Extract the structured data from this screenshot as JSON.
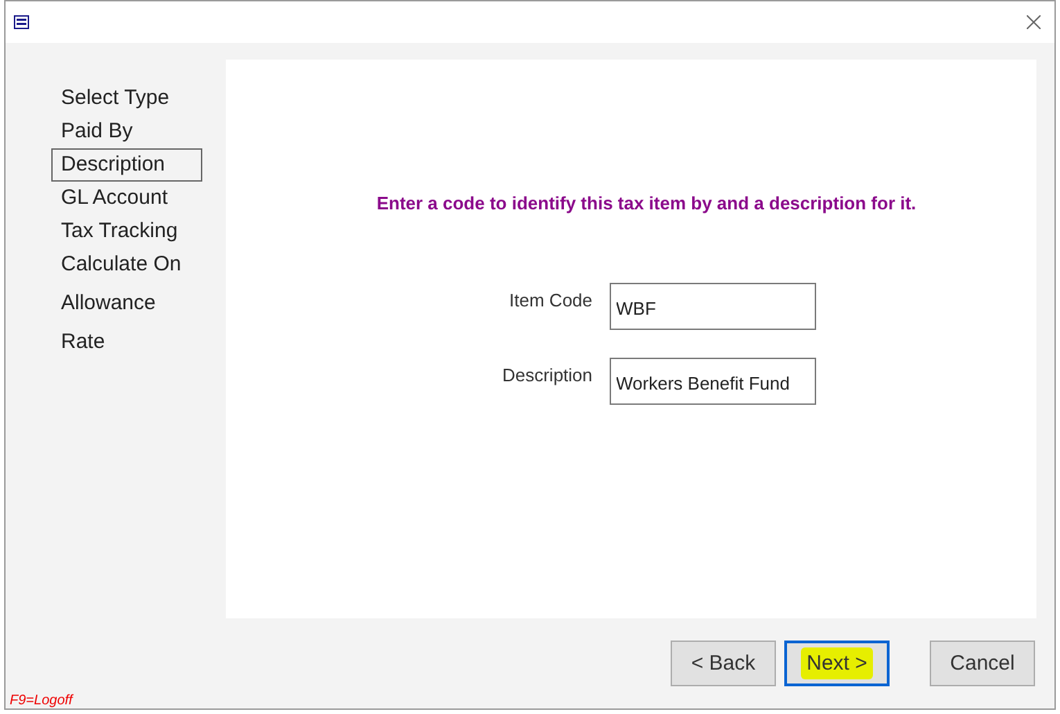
{
  "steps": [
    {
      "label": "Select Type",
      "selected": false
    },
    {
      "label": "Paid By",
      "selected": false
    },
    {
      "label": "Description",
      "selected": true
    },
    {
      "label": "GL Account",
      "selected": false
    },
    {
      "label": "Tax Tracking",
      "selected": false
    },
    {
      "label": "Calculate On",
      "selected": false
    },
    {
      "label": "Allowance",
      "selected": false
    },
    {
      "label": "Rate",
      "selected": false
    }
  ],
  "instruction": "Enter a code to identify this tax item by and a description for it.",
  "fields": [
    {
      "label": "Item Code",
      "value": "WBF"
    },
    {
      "label": "Description",
      "value": "Workers Benefit Fund"
    }
  ],
  "buttons": [
    {
      "label": "< Back",
      "default": false,
      "highlighted": false
    },
    {
      "label": "Next >",
      "default": true,
      "highlighted": true
    },
    {
      "label": "Cancel",
      "default": false,
      "highlighted": false
    }
  ],
  "status_hint": "F9=Logoff"
}
